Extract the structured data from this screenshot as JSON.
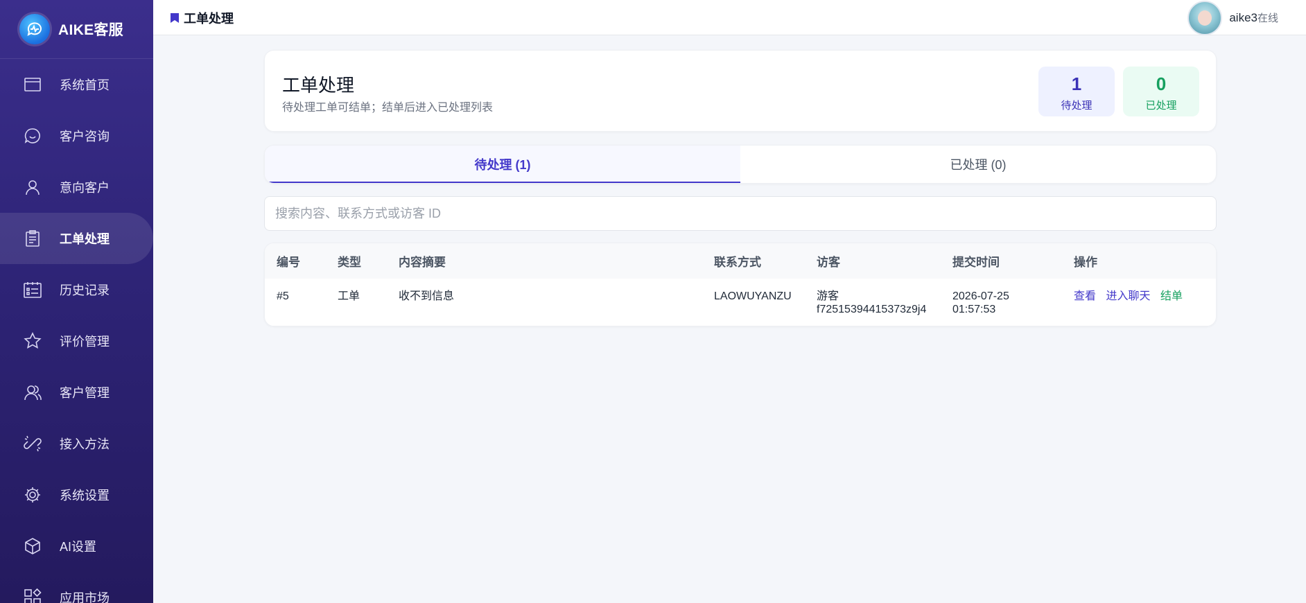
{
  "brand": {
    "name": "AIKE客服"
  },
  "sidebar": {
    "items": [
      {
        "label": "系统首页",
        "icon": "window-icon"
      },
      {
        "label": "客户咨询",
        "icon": "chat-bubble-icon"
      },
      {
        "label": "意向客户",
        "icon": "user-icon"
      },
      {
        "label": "工单处理",
        "icon": "clipboard-icon",
        "active": true
      },
      {
        "label": "历史记录",
        "icon": "calendar-list-icon"
      },
      {
        "label": "评价管理",
        "icon": "star-icon"
      },
      {
        "label": "客户管理",
        "icon": "users-icon"
      },
      {
        "label": "接入方法",
        "icon": "link-icon"
      },
      {
        "label": "系统设置",
        "icon": "gear-icon"
      },
      {
        "label": "AI设置",
        "icon": "cube-icon"
      },
      {
        "label": "应用市场",
        "icon": "apps-grid-icon"
      }
    ]
  },
  "header": {
    "breadcrumb": "工单处理",
    "user": {
      "name": "aike3",
      "status": "在线"
    }
  },
  "hero": {
    "title": "工单处理",
    "subtitle": "待处理工单可结单；结单后进入已处理列表",
    "stats": {
      "pending": {
        "value": "1",
        "label": "待处理"
      },
      "done": {
        "value": "0",
        "label": "已处理"
      }
    }
  },
  "tabs": [
    {
      "label": "待处理 (1)",
      "active": true
    },
    {
      "label": "已处理 (0)",
      "active": false
    }
  ],
  "search": {
    "placeholder": "搜索内容、联系方式或访客 ID",
    "value": ""
  },
  "table": {
    "columns": [
      "编号",
      "类型",
      "内容摘要",
      "联系方式",
      "访客",
      "提交时间",
      "操作"
    ],
    "rows": [
      {
        "id": "#5",
        "type": "工单",
        "summary": "收不到信息",
        "contact": "LAOWUYANZU",
        "visitor_line1": "游客",
        "visitor_line2": "f72515394415373z9j4",
        "time_line1": "2026-07-25",
        "time_line2": "01:57:53",
        "actions": {
          "view": "查看",
          "chat": "进入聊天",
          "close": "结单"
        }
      }
    ]
  },
  "colors": {
    "accent": "#4338ca",
    "success": "#16a05f",
    "sidebar": "#2e2477"
  }
}
